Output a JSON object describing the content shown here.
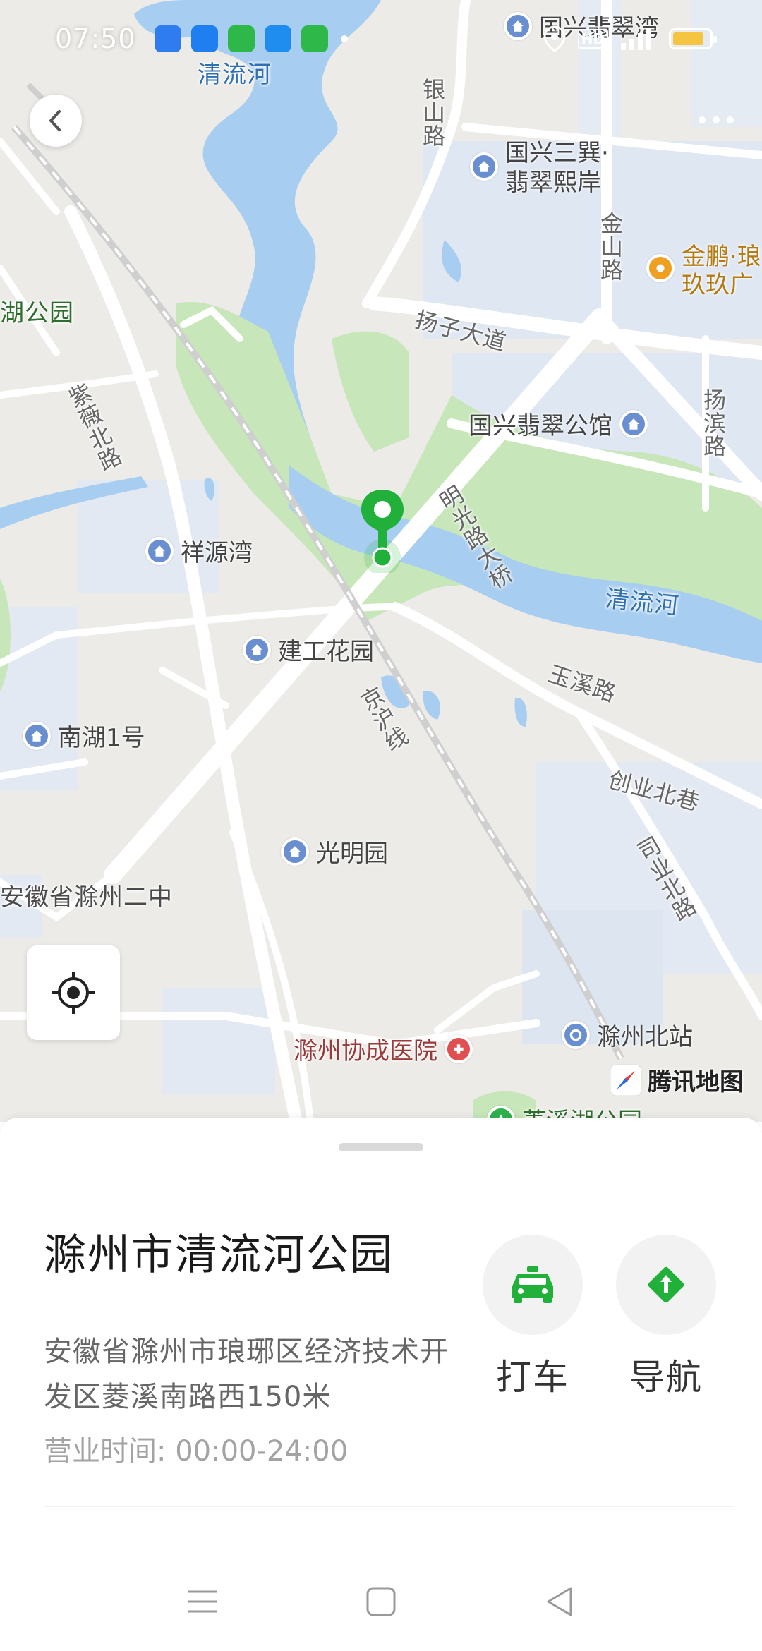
{
  "status_bar": {
    "time": "07:50",
    "app_icon_colors": [
      "#2f7bf0",
      "#1f7ef0",
      "#2fb84a",
      "#1f8cf0",
      "#2fb84a"
    ],
    "network_label": "HD",
    "battery_level": 0.85,
    "battery_color": "#f5c542"
  },
  "map": {
    "labels": {
      "qingliuhe_top": "清流河",
      "guoxing_feicuiwan": "国兴翡翠湾",
      "yinshan_road": "银山路",
      "guoxing_sanxun_1": "国兴三巽·",
      "guoxing_sanxun_2": "翡翠熙岸",
      "jinshan_road": "金山路",
      "jinpeng_1": "金鹏·琅",
      "jinpeng_2": "玖玖广",
      "hu_park": "湖公园",
      "yangzi_avenue": "扬子大道",
      "guoxing_gongguan": "国兴翡翠公馆",
      "yangbin_road": "扬滨路",
      "ziwei_north_road": "紫薇北路",
      "xiangyuanwan": "祥源湾",
      "mingguang_bridge": "明光路大桥",
      "qingliuhe_main": "清流河",
      "jiangong_garden": "建工花园",
      "yuxi_road": "玉溪路",
      "jingjiu_line": "京沪线",
      "nanhu_1": "南湖1号",
      "chuangye_north_lane": "创业北巷",
      "guangming_garden": "光明园",
      "siyuan_north_road": "司业北路",
      "anhui_chuzhou_2nd": "安徽省滁州二中",
      "hospital": "滁州协成医院",
      "chuzhou_north_station": "滁州北站",
      "lingxi_park": "菱溪湖公园"
    },
    "brand": "腾讯地图",
    "marker_color": "#21b03a"
  },
  "place": {
    "name": "滁州市清流河公园",
    "address": "安徽省滁州市琅琊区经济技术开发区菱溪南路西150米",
    "hours": "营业时间: 00:00-24:00"
  },
  "actions": {
    "taxi_label": "打车",
    "nav_label": "导航",
    "accent": "#21b03a"
  }
}
